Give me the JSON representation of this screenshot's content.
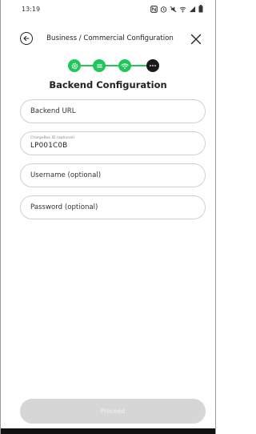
{
  "status_bar": {
    "time": "13:19"
  },
  "header": {
    "title": "Business / Commercial Configuration"
  },
  "stepper": {
    "steps": [
      {
        "icon": "gear-icon",
        "state": "done"
      },
      {
        "icon": "list-icon",
        "state": "done"
      },
      {
        "icon": "wifi-icon",
        "state": "done"
      },
      {
        "icon": "more-icon",
        "state": "active"
      }
    ],
    "accent_color": "#1fc65a",
    "active_color": "#1a1a1a"
  },
  "section_title": "Backend Configuration",
  "form": {
    "backend_url_placeholder": "Backend URL",
    "chargebox_label": "ChargeBox ID (optional)",
    "chargebox_value": "LP001C0B",
    "username_placeholder": "Username (optional)",
    "password_placeholder": "Password (optional)"
  },
  "proceed_label": "Proceed"
}
